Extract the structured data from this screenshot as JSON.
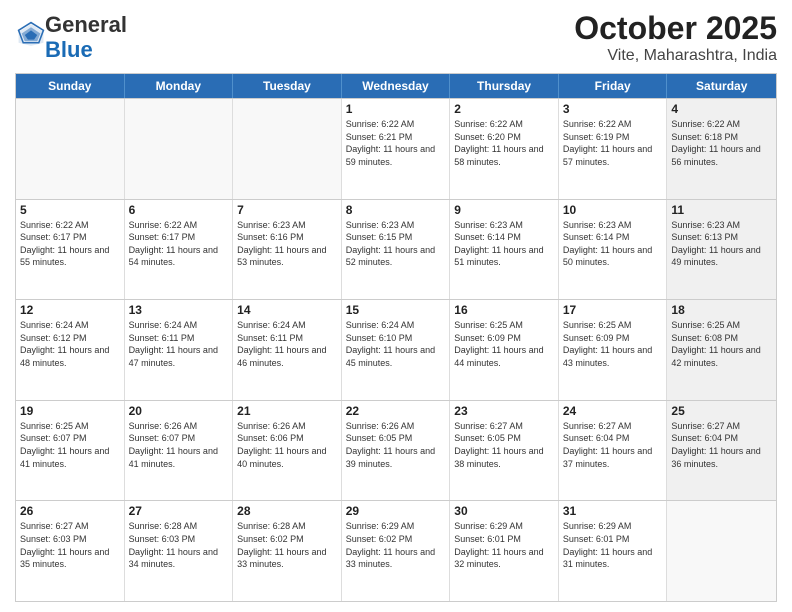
{
  "header": {
    "logo_general": "General",
    "logo_blue": "Blue",
    "title": "October 2025",
    "subtitle": "Vite, Maharashtra, India"
  },
  "days_of_week": [
    "Sunday",
    "Monday",
    "Tuesday",
    "Wednesday",
    "Thursday",
    "Friday",
    "Saturday"
  ],
  "weeks": [
    [
      {
        "day": "",
        "sunrise": "",
        "sunset": "",
        "daylight": "",
        "shaded": false,
        "empty": true
      },
      {
        "day": "",
        "sunrise": "",
        "sunset": "",
        "daylight": "",
        "shaded": false,
        "empty": true
      },
      {
        "day": "",
        "sunrise": "",
        "sunset": "",
        "daylight": "",
        "shaded": false,
        "empty": true
      },
      {
        "day": "1",
        "sunrise": "Sunrise: 6:22 AM",
        "sunset": "Sunset: 6:21 PM",
        "daylight": "Daylight: 11 hours and 59 minutes.",
        "shaded": false,
        "empty": false
      },
      {
        "day": "2",
        "sunrise": "Sunrise: 6:22 AM",
        "sunset": "Sunset: 6:20 PM",
        "daylight": "Daylight: 11 hours and 58 minutes.",
        "shaded": false,
        "empty": false
      },
      {
        "day": "3",
        "sunrise": "Sunrise: 6:22 AM",
        "sunset": "Sunset: 6:19 PM",
        "daylight": "Daylight: 11 hours and 57 minutes.",
        "shaded": false,
        "empty": false
      },
      {
        "day": "4",
        "sunrise": "Sunrise: 6:22 AM",
        "sunset": "Sunset: 6:18 PM",
        "daylight": "Daylight: 11 hours and 56 minutes.",
        "shaded": true,
        "empty": false
      }
    ],
    [
      {
        "day": "5",
        "sunrise": "Sunrise: 6:22 AM",
        "sunset": "Sunset: 6:17 PM",
        "daylight": "Daylight: 11 hours and 55 minutes.",
        "shaded": false,
        "empty": false
      },
      {
        "day": "6",
        "sunrise": "Sunrise: 6:22 AM",
        "sunset": "Sunset: 6:17 PM",
        "daylight": "Daylight: 11 hours and 54 minutes.",
        "shaded": false,
        "empty": false
      },
      {
        "day": "7",
        "sunrise": "Sunrise: 6:23 AM",
        "sunset": "Sunset: 6:16 PM",
        "daylight": "Daylight: 11 hours and 53 minutes.",
        "shaded": false,
        "empty": false
      },
      {
        "day": "8",
        "sunrise": "Sunrise: 6:23 AM",
        "sunset": "Sunset: 6:15 PM",
        "daylight": "Daylight: 11 hours and 52 minutes.",
        "shaded": false,
        "empty": false
      },
      {
        "day": "9",
        "sunrise": "Sunrise: 6:23 AM",
        "sunset": "Sunset: 6:14 PM",
        "daylight": "Daylight: 11 hours and 51 minutes.",
        "shaded": false,
        "empty": false
      },
      {
        "day": "10",
        "sunrise": "Sunrise: 6:23 AM",
        "sunset": "Sunset: 6:14 PM",
        "daylight": "Daylight: 11 hours and 50 minutes.",
        "shaded": false,
        "empty": false
      },
      {
        "day": "11",
        "sunrise": "Sunrise: 6:23 AM",
        "sunset": "Sunset: 6:13 PM",
        "daylight": "Daylight: 11 hours and 49 minutes.",
        "shaded": true,
        "empty": false
      }
    ],
    [
      {
        "day": "12",
        "sunrise": "Sunrise: 6:24 AM",
        "sunset": "Sunset: 6:12 PM",
        "daylight": "Daylight: 11 hours and 48 minutes.",
        "shaded": false,
        "empty": false
      },
      {
        "day": "13",
        "sunrise": "Sunrise: 6:24 AM",
        "sunset": "Sunset: 6:11 PM",
        "daylight": "Daylight: 11 hours and 47 minutes.",
        "shaded": false,
        "empty": false
      },
      {
        "day": "14",
        "sunrise": "Sunrise: 6:24 AM",
        "sunset": "Sunset: 6:11 PM",
        "daylight": "Daylight: 11 hours and 46 minutes.",
        "shaded": false,
        "empty": false
      },
      {
        "day": "15",
        "sunrise": "Sunrise: 6:24 AM",
        "sunset": "Sunset: 6:10 PM",
        "daylight": "Daylight: 11 hours and 45 minutes.",
        "shaded": false,
        "empty": false
      },
      {
        "day": "16",
        "sunrise": "Sunrise: 6:25 AM",
        "sunset": "Sunset: 6:09 PM",
        "daylight": "Daylight: 11 hours and 44 minutes.",
        "shaded": false,
        "empty": false
      },
      {
        "day": "17",
        "sunrise": "Sunrise: 6:25 AM",
        "sunset": "Sunset: 6:09 PM",
        "daylight": "Daylight: 11 hours and 43 minutes.",
        "shaded": false,
        "empty": false
      },
      {
        "day": "18",
        "sunrise": "Sunrise: 6:25 AM",
        "sunset": "Sunset: 6:08 PM",
        "daylight": "Daylight: 11 hours and 42 minutes.",
        "shaded": true,
        "empty": false
      }
    ],
    [
      {
        "day": "19",
        "sunrise": "Sunrise: 6:25 AM",
        "sunset": "Sunset: 6:07 PM",
        "daylight": "Daylight: 11 hours and 41 minutes.",
        "shaded": false,
        "empty": false
      },
      {
        "day": "20",
        "sunrise": "Sunrise: 6:26 AM",
        "sunset": "Sunset: 6:07 PM",
        "daylight": "Daylight: 11 hours and 41 minutes.",
        "shaded": false,
        "empty": false
      },
      {
        "day": "21",
        "sunrise": "Sunrise: 6:26 AM",
        "sunset": "Sunset: 6:06 PM",
        "daylight": "Daylight: 11 hours and 40 minutes.",
        "shaded": false,
        "empty": false
      },
      {
        "day": "22",
        "sunrise": "Sunrise: 6:26 AM",
        "sunset": "Sunset: 6:05 PM",
        "daylight": "Daylight: 11 hours and 39 minutes.",
        "shaded": false,
        "empty": false
      },
      {
        "day": "23",
        "sunrise": "Sunrise: 6:27 AM",
        "sunset": "Sunset: 6:05 PM",
        "daylight": "Daylight: 11 hours and 38 minutes.",
        "shaded": false,
        "empty": false
      },
      {
        "day": "24",
        "sunrise": "Sunrise: 6:27 AM",
        "sunset": "Sunset: 6:04 PM",
        "daylight": "Daylight: 11 hours and 37 minutes.",
        "shaded": false,
        "empty": false
      },
      {
        "day": "25",
        "sunrise": "Sunrise: 6:27 AM",
        "sunset": "Sunset: 6:04 PM",
        "daylight": "Daylight: 11 hours and 36 minutes.",
        "shaded": true,
        "empty": false
      }
    ],
    [
      {
        "day": "26",
        "sunrise": "Sunrise: 6:27 AM",
        "sunset": "Sunset: 6:03 PM",
        "daylight": "Daylight: 11 hours and 35 minutes.",
        "shaded": false,
        "empty": false
      },
      {
        "day": "27",
        "sunrise": "Sunrise: 6:28 AM",
        "sunset": "Sunset: 6:03 PM",
        "daylight": "Daylight: 11 hours and 34 minutes.",
        "shaded": false,
        "empty": false
      },
      {
        "day": "28",
        "sunrise": "Sunrise: 6:28 AM",
        "sunset": "Sunset: 6:02 PM",
        "daylight": "Daylight: 11 hours and 33 minutes.",
        "shaded": false,
        "empty": false
      },
      {
        "day": "29",
        "sunrise": "Sunrise: 6:29 AM",
        "sunset": "Sunset: 6:02 PM",
        "daylight": "Daylight: 11 hours and 33 minutes.",
        "shaded": false,
        "empty": false
      },
      {
        "day": "30",
        "sunrise": "Sunrise: 6:29 AM",
        "sunset": "Sunset: 6:01 PM",
        "daylight": "Daylight: 11 hours and 32 minutes.",
        "shaded": false,
        "empty": false
      },
      {
        "day": "31",
        "sunrise": "Sunrise: 6:29 AM",
        "sunset": "Sunset: 6:01 PM",
        "daylight": "Daylight: 11 hours and 31 minutes.",
        "shaded": false,
        "empty": false
      },
      {
        "day": "",
        "sunrise": "",
        "sunset": "",
        "daylight": "",
        "shaded": true,
        "empty": true
      }
    ]
  ]
}
